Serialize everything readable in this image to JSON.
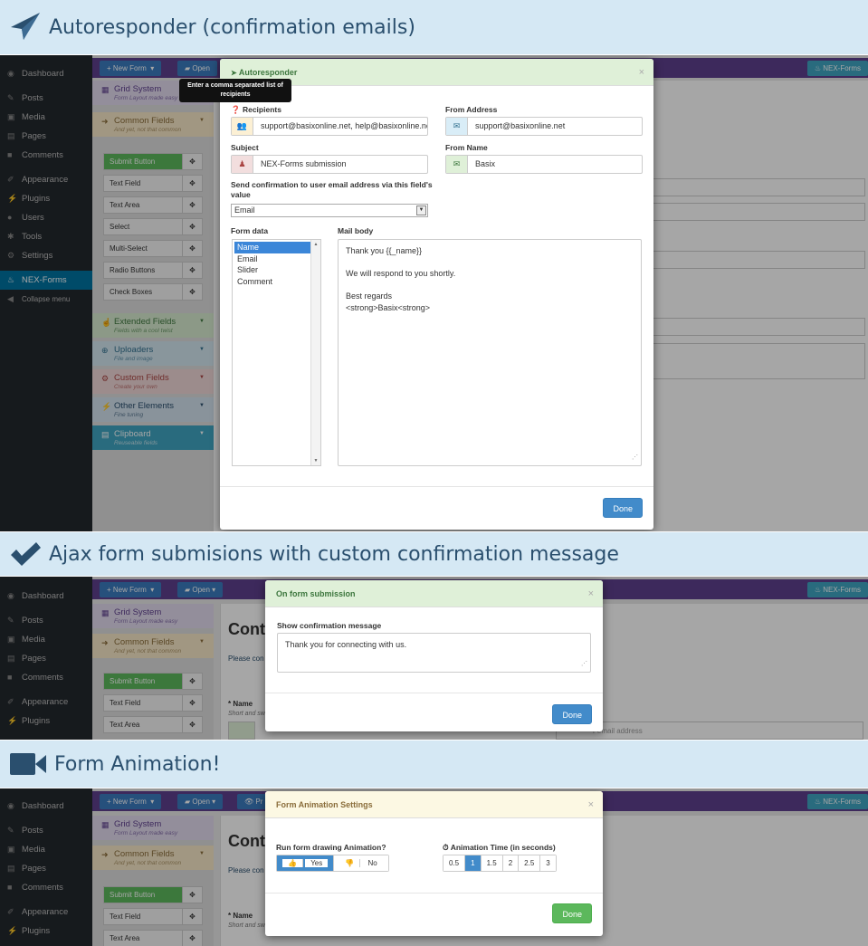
{
  "banners": [
    {
      "title": "Autoresponder (confirmation emails)",
      "icon": "paper-plane-icon"
    },
    {
      "title": "Ajax form submisions with custom confirmation message",
      "icon": "checkmark-icon"
    },
    {
      "title": "Form Animation!",
      "icon": "video-camera-icon"
    }
  ],
  "wp_menu": [
    {
      "label": "Dashboard",
      "icon": "dashboard-icon"
    },
    {
      "label": "Posts",
      "icon": "pin-icon"
    },
    {
      "label": "Media",
      "icon": "media-icon"
    },
    {
      "label": "Pages",
      "icon": "pages-icon"
    },
    {
      "label": "Comments",
      "icon": "comments-icon"
    },
    {
      "label": "Appearance",
      "icon": "brush-icon"
    },
    {
      "label": "Plugins",
      "icon": "plug-icon"
    },
    {
      "label": "Users",
      "icon": "users-icon"
    },
    {
      "label": "Tools",
      "icon": "wrench-icon"
    },
    {
      "label": "Settings",
      "icon": "settings-icon"
    },
    {
      "label": "NEX-Forms",
      "icon": "nex-forms-icon"
    },
    {
      "label": "Collapse menu",
      "icon": "collapse-icon"
    }
  ],
  "toolbar": {
    "new_form": "New Form",
    "open": "Open",
    "nex_forms": "NEX-Forms"
  },
  "panel": {
    "grid": {
      "title": "Grid System",
      "sub": "Form Layout made easy"
    },
    "common": {
      "title": "Common Fields",
      "sub": "And yet, not that common"
    },
    "buttons": [
      "Submit Button",
      "Text Field",
      "Text Area",
      "Select",
      "Multi-Select",
      "Radio Buttons",
      "Check Boxes"
    ],
    "extended": {
      "title": "Extended Fields",
      "sub": "Fields with a cool twist"
    },
    "uploaders": {
      "title": "Uploaders",
      "sub": "File and image"
    },
    "custom": {
      "title": "Custom Fields",
      "sub": "Create your own"
    },
    "other": {
      "title": "Other Elements",
      "sub": "Fine tuning"
    },
    "clipboard": {
      "title": "Clipboard",
      "sub": "Reuseable fields"
    }
  },
  "autoresponder": {
    "title": "Autoresponder",
    "tooltip": "Enter a comma separated list of recipients",
    "recipients_label": "Recipients",
    "recipients_value": "support@basixonline.net, help@basixonline.net",
    "from_address_label": "From Address",
    "from_address_value": "support@basixonline.net",
    "subject_label": "Subject",
    "subject_value": "NEX-Forms submission",
    "from_name_label": "From Name",
    "from_name_value": "Basix",
    "send_label": "Send confirmation to user email address via this field's value",
    "send_value": "Email",
    "form_data_label": "Form data",
    "form_data_options": [
      "Name",
      "Email",
      "Slider",
      "Comment"
    ],
    "mail_body_label": "Mail body",
    "mail_body_lines": [
      "Thank you {{_name}}",
      "",
      "We will respond to you shortly.",
      "",
      "Best regards",
      "<strong>Basix<strong>"
    ],
    "done": "Done"
  },
  "submission": {
    "title": "On form submission",
    "label": "Show confirmation message",
    "message": "Thank you for connecting with us.",
    "done": "Done",
    "bg_heading": "Conta",
    "bg_please": "Please con",
    "bg_name": "Name",
    "bg_short": "Short and swee",
    "bg_email_placeholder": "r email address"
  },
  "animation": {
    "title": "Form Animation Settings",
    "run_label": "Run form drawing Animation?",
    "yes": "Yes",
    "no": "No",
    "time_label": "Animation Time (in seconds)",
    "times": [
      "0.5",
      "1",
      "1.5",
      "2",
      "2.5",
      "3"
    ],
    "time_selected": "1",
    "done": "Done",
    "bg_heading": "Conta",
    "bg_please": "Please con",
    "bg_name": "Name",
    "bg_short": "Short and swee",
    "bg_preview": "Pr"
  },
  "colors": {
    "banner_bg": "#d5e8f4",
    "banner_text": "#2a4f6e",
    "wp_dark": "#23282d",
    "topbar": "#5e3f8e",
    "primary": "#428bca",
    "success": "#5cb85c"
  }
}
